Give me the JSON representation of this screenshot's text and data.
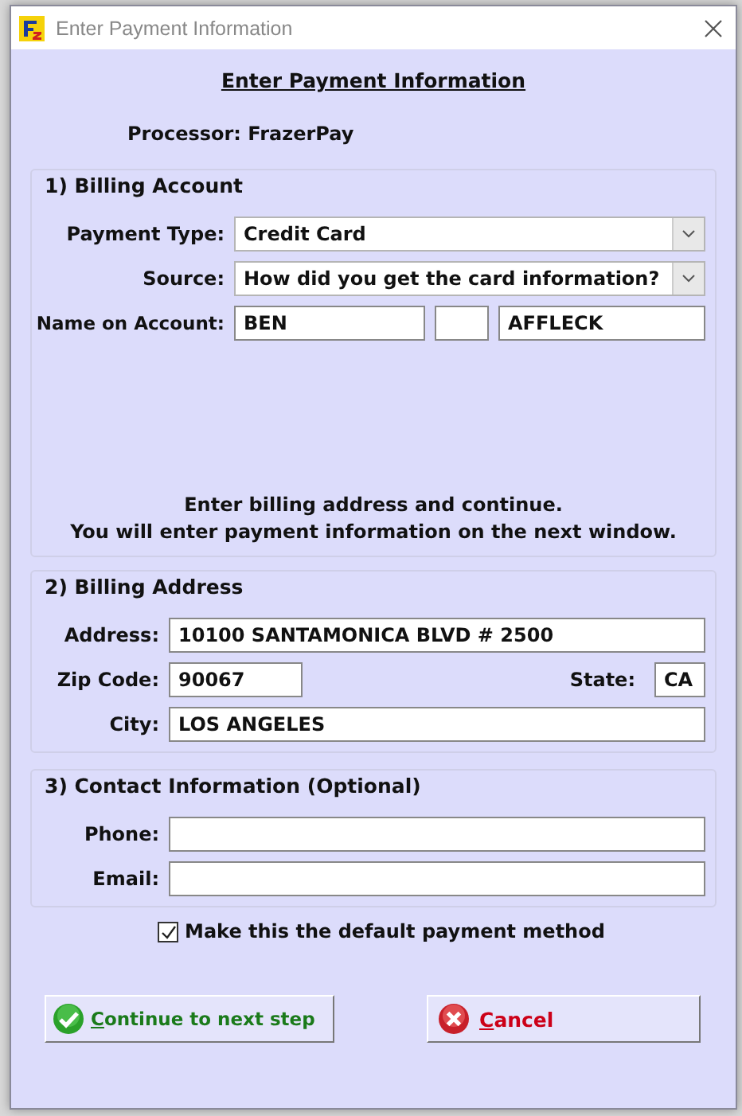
{
  "window": {
    "title": "Enter Payment Information"
  },
  "heading": "Enter Payment Information",
  "processor": "Processor: FrazerPay",
  "sections": [
    {
      "title": "1) Billing Account",
      "kind": "account",
      "rows": [
        {
          "label": "Payment Type:",
          "fields": [
            {
              "kind": "select",
              "value": "Credit Card"
            }
          ]
        },
        {
          "label": "Source:",
          "fields": [
            {
              "kind": "select",
              "value": "How did you get the card information?"
            }
          ]
        },
        {
          "label": "Name on Account:",
          "fields": [
            {
              "kind": "first",
              "value": "BEN"
            },
            {
              "kind": "middle"
            },
            {
              "kind": "last",
              "value": "AFFLECK"
            }
          ]
        }
      ],
      "note": [
        "Enter billing address and continue.",
        "You will enter payment information on the next window."
      ]
    },
    {
      "title": "2) Billing Address",
      "kind": "address",
      "rows": [
        {
          "label": "Address:",
          "fields": [
            {
              "kind": "text",
              "value": "10100 SANTAMONICA BLVD # 2500"
            }
          ]
        },
        {
          "label": "Zip Code:",
          "fields": [
            {
              "kind": "zip",
              "value": "90067"
            },
            {
              "kind": "state",
              "label": "State:",
              "value": "CA"
            }
          ]
        },
        {
          "label": "City:",
          "fields": [
            {
              "kind": "text",
              "value": "LOS ANGELES"
            }
          ]
        }
      ]
    },
    {
      "title": "3) Contact Information (Optional)",
      "kind": "contact",
      "rows": [
        {
          "label": "Phone:",
          "fields": [
            {
              "kind": "text"
            }
          ]
        },
        {
          "label": "Email:",
          "fields": [
            {
              "kind": "text"
            }
          ]
        }
      ]
    }
  ],
  "default_checkbox": {
    "label": "Make this the default payment method",
    "checked": true
  },
  "buttons": [
    {
      "kind": "confirm",
      "label": "Continue to next step",
      "mnemonic": true
    },
    {
      "kind": "cancel",
      "label": "Cancel",
      "mnemonic": true
    }
  ]
}
